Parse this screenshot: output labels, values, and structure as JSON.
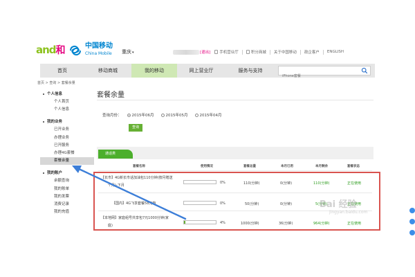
{
  "header": {
    "logo_and": "and",
    "logo_he": "和",
    "logo_cn": "中国移动",
    "logo_en": "China Mobile",
    "city": "重庆",
    "logout": "[退出]",
    "links": [
      "手机营业厅",
      "积分商城",
      "关于中国移动",
      "政企客户",
      "ENGLISH"
    ]
  },
  "nav": {
    "items": [
      "首页",
      "移动商城",
      "我的移动",
      "网上营业厅",
      "服务与支持"
    ],
    "active_index": 2,
    "search_placeholder": "iPhone套餐"
  },
  "breadcrumb": "首页 > 查询 > 套餐余量",
  "sidebar": {
    "groups": [
      {
        "title": "个人信息",
        "items": [
          "个人首页",
          "个人信息"
        ]
      },
      {
        "title": "我的业务",
        "items": [
          "已开业务",
          "办理业务",
          "已开服务",
          "办理4G套餐",
          "套餐余量"
        ]
      },
      {
        "title": "我的账户",
        "items": [
          "余额查询",
          "我的账单",
          "我的发票",
          "消费记录",
          "我的充值"
        ]
      }
    ],
    "active_item": "套餐余量"
  },
  "main": {
    "title": "套餐余量",
    "month_label": "查询月份：",
    "months": [
      "2015年06月",
      "2015年05月",
      "2015年04月"
    ],
    "checked_month": 0,
    "query_button": "查询",
    "tab_label": "通话类",
    "columns": [
      "套餐名称",
      "使用情况",
      "套餐总量",
      "本月已用",
      "本月剩余",
      "套餐状态"
    ],
    "rows": [
      {
        "name_line1": "【长市】4G新长市话加油包110分钟(按月赠送",
        "name_line2": "个月)-下月",
        "usage_pct": 0,
        "usage_label": "0%",
        "total": "110(分钟)",
        "used": "0(分钟)",
        "remaining": "110(分钟)",
        "status": "正在使用"
      },
      {
        "name_line1": "【国内】4G飞享套餐58元档",
        "name_line2": "",
        "usage_pct": 0,
        "usage_label": "0%",
        "total": "50(分钟)",
        "used": "0(分钟)",
        "remaining": "5(分钟)",
        "status": "正在使用"
      },
      {
        "name_line1": "【本地网】家庭组号共享包7元1000分钟(家",
        "name_line2": "庭)",
        "usage_pct": 4,
        "usage_label": "4%",
        "total": "1000(分钟)",
        "used": "36(分钟)",
        "remaining": "964(分钟)",
        "status": "正在使用"
      }
    ]
  },
  "watermark": {
    "big": "Bai 经验",
    "small": "jingyan.baidu.com"
  },
  "colors": {
    "brand_green": "#66b034",
    "tab_green": "#4caf2c",
    "highlight_red": "#d9534f",
    "arrow_blue": "#3c7ed8",
    "china_mobile_blue": "#0085d0",
    "logout_pink": "#e4007f"
  }
}
